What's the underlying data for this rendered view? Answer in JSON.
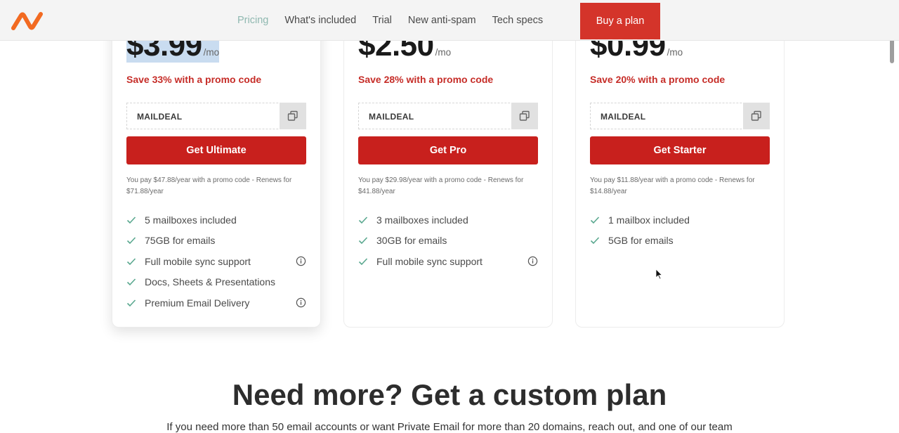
{
  "nav": {
    "links": [
      "Pricing",
      "What's included",
      "Trial",
      "New anti-spam",
      "Tech specs"
    ],
    "cta_label": "Buy a plan",
    "accent_color": "#d4342a"
  },
  "plans": [
    {
      "price": "$3.99",
      "per": "/mo",
      "save": "Save 33% with a promo code",
      "promo_code": "MAILDEAL",
      "cta": "Get Ultimate",
      "fine_print": "You pay $47.88/year with a promo code - Renews for $71.88/year",
      "features": [
        "5 mailboxes included",
        "75GB for emails",
        "Full mobile sync support",
        "Docs, Sheets & Presentations",
        "Premium Email Delivery"
      ]
    },
    {
      "price": "$2.50",
      "per": "/mo",
      "save": "Save 28% with a promo code",
      "promo_code": "MAILDEAL",
      "cta": "Get Pro",
      "fine_print": "You pay $29.98/year with a promo code - Renews for $41.88/year",
      "features": [
        "3 mailboxes included",
        "30GB for emails",
        "Full mobile sync support"
      ]
    },
    {
      "price": "$0.99",
      "per": "/mo",
      "save": "Save 20% with a promo code",
      "promo_code": "MAILDEAL",
      "cta": "Get Starter",
      "fine_print": "You pay $11.88/year with a promo code - Renews for $14.88/year",
      "features": [
        "1 mailbox included",
        "5GB for emails"
      ]
    }
  ],
  "custom": {
    "headline": "Need more? Get a custom plan",
    "subtext": "If you need more than 50 email accounts or want Private Email for more than 20 domains, reach out, and one of our team"
  },
  "icons": {
    "logo": "namecheap-logo-icon",
    "copy": "copy-icon",
    "check": "check-icon",
    "info": "info-icon"
  },
  "colors": {
    "cta_red": "#c8201d",
    "save_red": "#c62d28",
    "check_green": "#5aa88f",
    "active_nav": "#8fb8b0"
  }
}
